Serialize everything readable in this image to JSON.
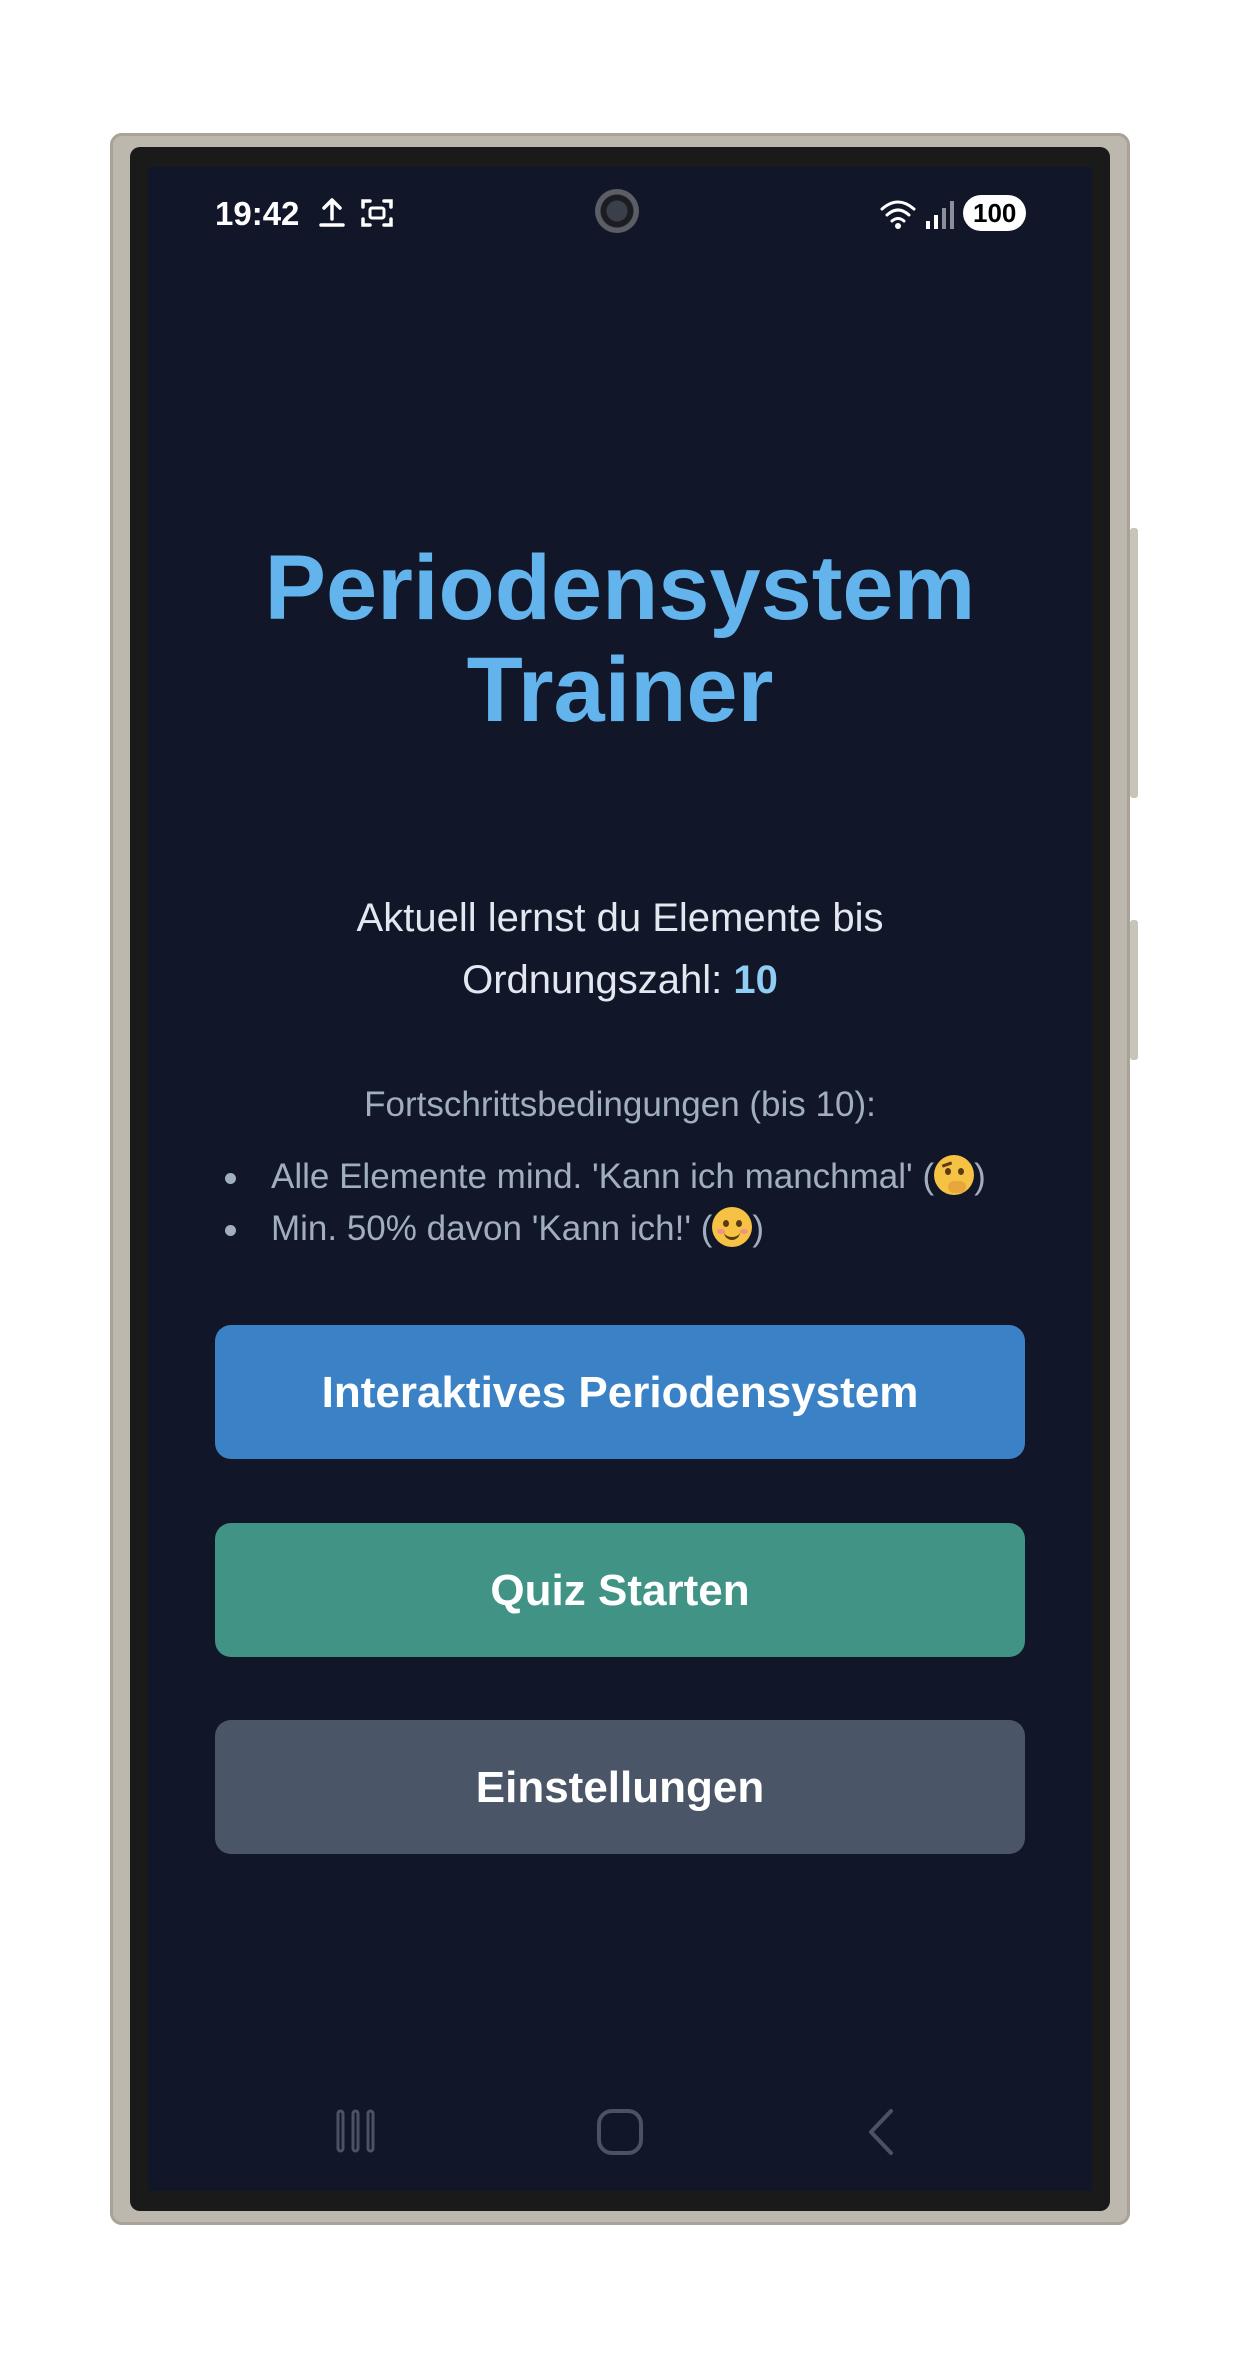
{
  "status_bar": {
    "time": "19:42",
    "icons": [
      "upload-icon",
      "screenshot-icon",
      "camera-cutout",
      "wifi-icon",
      "signal-icon"
    ],
    "battery": "100"
  },
  "app": {
    "title_line1": "Periodensystem",
    "title_line2": "Trainer",
    "level_text_prefix": "Aktuell lernst du Elemente bis Ordnungszahl: ",
    "level_value": "10",
    "conditions_heading": "Fortschrittsbedingungen (bis 10):",
    "conditions": [
      {
        "text": "Alle Elemente mind. 'Kann ich manchmal' (",
        "emoji": "thinking-face-emoji",
        "suffix": ")"
      },
      {
        "text": "Min. 50% davon 'Kann ich!' (",
        "emoji": "smiling-face-emoji",
        "suffix": ")"
      }
    ],
    "buttons": {
      "periodic_table": "Interaktives Periodensystem",
      "quiz": "Quiz Starten",
      "settings": "Einstellungen"
    },
    "colors": {
      "background": "#111628",
      "title": "#63b3ed",
      "button_periodic": "#3a82c5",
      "button_quiz": "#419385",
      "button_settings": "#4a5568"
    }
  },
  "nav_bar": {
    "icons": [
      "recent-apps-icon",
      "home-icon",
      "back-icon"
    ]
  }
}
